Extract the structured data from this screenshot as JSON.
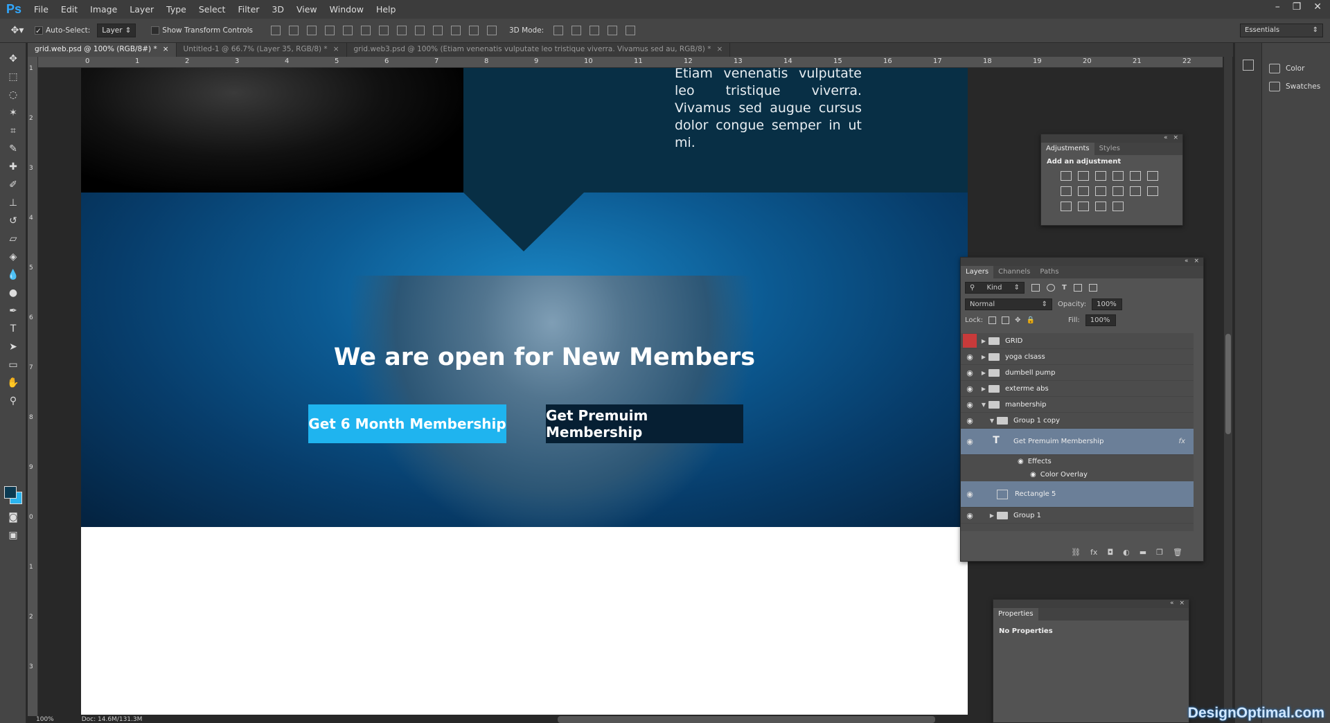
{
  "app": {
    "logo": "Ps"
  },
  "menu": [
    "File",
    "Edit",
    "Image",
    "Layer",
    "Type",
    "Select",
    "Filter",
    "3D",
    "View",
    "Window",
    "Help"
  ],
  "window_controls": [
    "–",
    "❐",
    "✕"
  ],
  "options": {
    "auto_select_label": "Auto-Select:",
    "auto_select_value": "Layer",
    "show_transform_label": "Show Transform Controls",
    "mode3d_label": "3D Mode:",
    "workspace": "Essentials"
  },
  "tabs": [
    {
      "label": "grid.web.psd @ 100% (RGB/8#) *",
      "close": "×"
    },
    {
      "label": "Untitled-1 @ 66.7% (Layer 35, RGB/8) *",
      "close": "×"
    },
    {
      "label": "grid.web3.psd @ 100% (Etiam venenatis vulputate leo tristique viverra. Vivamus sed au, RGB/8) *",
      "close": "×"
    }
  ],
  "ruler_top": [
    "0",
    "1",
    "2",
    "3",
    "4",
    "5",
    "6",
    "7",
    "8",
    "9",
    "10",
    "11",
    "12",
    "13",
    "14",
    "15",
    "16",
    "17",
    "18",
    "19",
    "20",
    "21",
    "22"
  ],
  "ruler_left": [
    "1",
    "2",
    "3",
    "4",
    "5",
    "6",
    "7",
    "8",
    "9",
    "0",
    "1",
    "2",
    "3"
  ],
  "canvas": {
    "top_text": "Etiam venenatis vulputate leo tristique viverra. Vivamus sed augue cursus dolor congue semper in ut mi.",
    "hero_title": "We are open for New Members",
    "button1": "Get 6 Month Membership",
    "button2": "Get Premuim Membership",
    "colors": {
      "band": "#082f45",
      "button1": "#1fb4ef",
      "button2": "#061f33"
    }
  },
  "status": {
    "zoom": "100%",
    "doc": "Doc: 14.6M/131.3M"
  },
  "dock": {
    "color": "Color",
    "swatches": "Swatches"
  },
  "adjustments": {
    "tabs": [
      "Adjustments",
      "Styles"
    ],
    "heading": "Add an adjustment"
  },
  "layers_panel": {
    "tabs": [
      "Layers",
      "Channels",
      "Paths"
    ],
    "kind": "Kind",
    "blend": "Normal",
    "opacity_label": "Opacity:",
    "opacity": "100%",
    "lock_label": "Lock:",
    "fill_label": "Fill:",
    "fill": "100%",
    "layers": [
      {
        "name": "GRID"
      },
      {
        "name": "yoga clsass"
      },
      {
        "name": "dumbell pump"
      },
      {
        "name": "exterme abs"
      },
      {
        "name": "manbership"
      },
      {
        "name": "Group 1 copy"
      },
      {
        "name": "Get Premuim Membership"
      },
      {
        "name": "Effects"
      },
      {
        "name": "Color Overlay"
      },
      {
        "name": "Rectangle 5"
      },
      {
        "name": "Group 1"
      }
    ]
  },
  "properties": {
    "tab": "Properties",
    "text": "No Properties"
  },
  "watermark": "DesignOptimal.com"
}
